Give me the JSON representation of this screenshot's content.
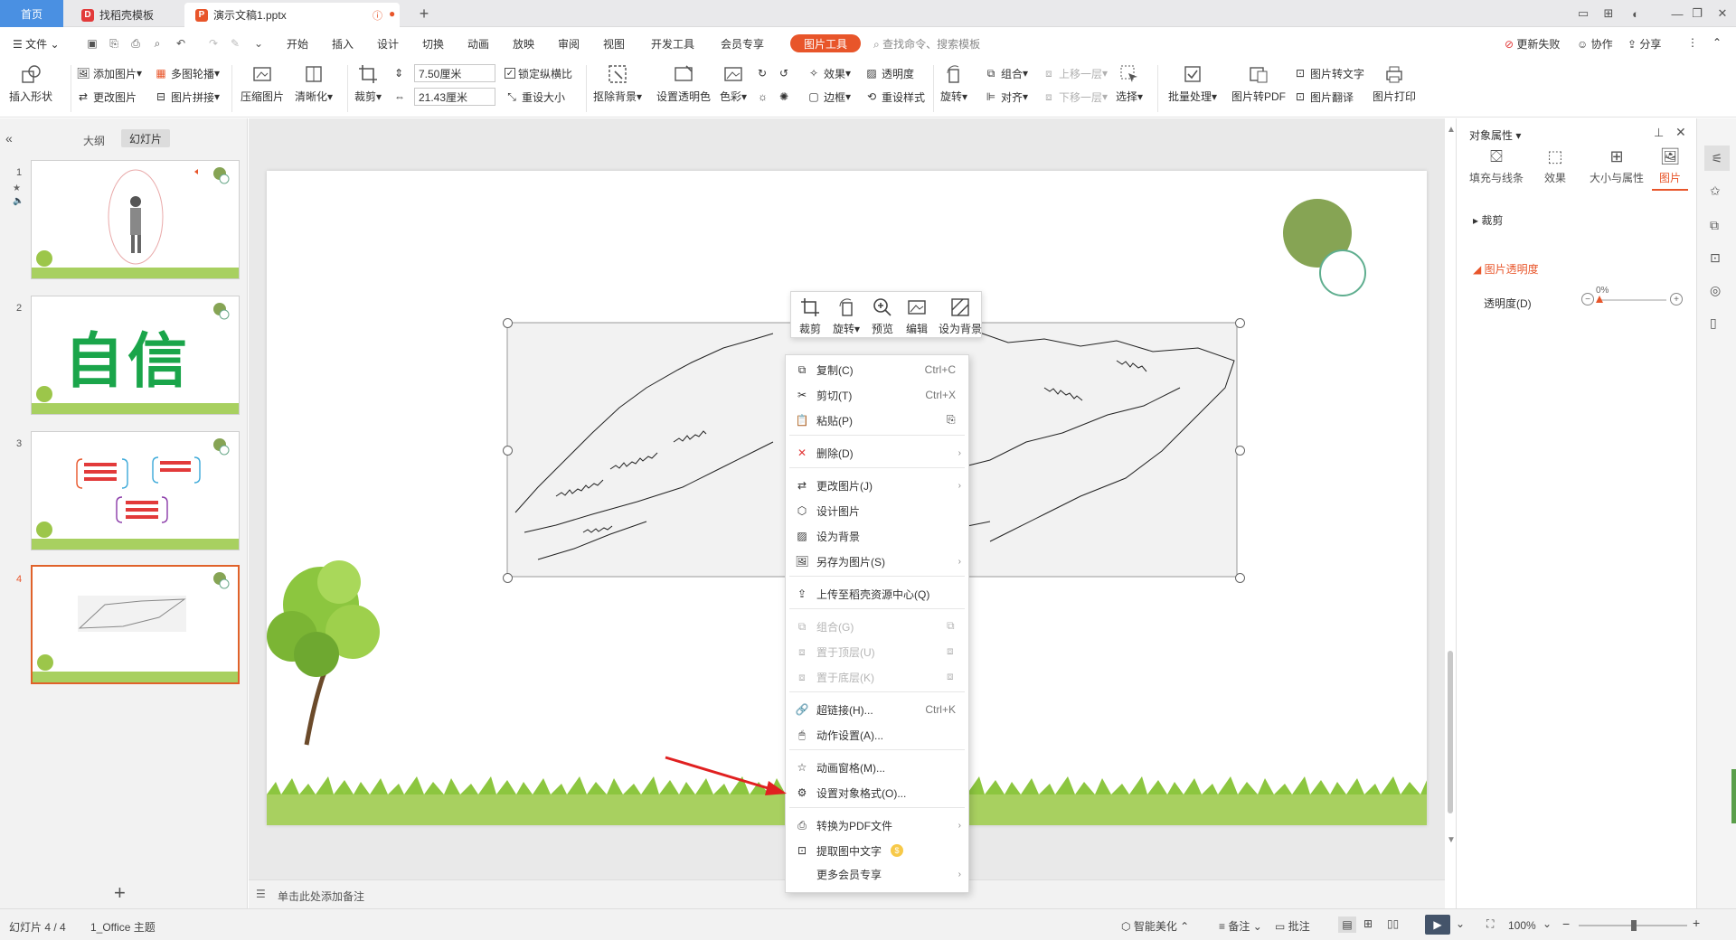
{
  "tabs": {
    "home": "首页",
    "template": "找稻壳模板",
    "document": "演示文稿1.pptx"
  },
  "menubar": {
    "file": "文件",
    "items": [
      "开始",
      "插入",
      "设计",
      "切换",
      "动画",
      "放映",
      "审阅",
      "视图",
      "开发工具",
      "会员专享"
    ],
    "active_tab": "图片工具",
    "search": "查找命令、搜索模板",
    "update_failed": "更新失败",
    "collaborate": "协作",
    "share": "分享"
  },
  "ribbon": {
    "insert_shape": "插入形状",
    "add_picture": "添加图片",
    "multi_outline": "多图轮播",
    "change_picture": "更改图片",
    "picture_splice": "图片拼接",
    "compress": "压缩图片",
    "sharpen": "清晰化",
    "crop": "裁剪",
    "width": "7.50厘米",
    "height": "21.43厘米",
    "lock_ratio": "锁定纵横比",
    "reset_size": "重设大小",
    "remove_bg": "抠除背景",
    "set_transparent": "设置透明色",
    "color": "色彩",
    "effect": "效果",
    "transparency": "透明度",
    "border": "边框",
    "reset_style": "重设样式",
    "rotate": "旋转",
    "group": "组合",
    "align": "对齐",
    "bring_forward": "上移一层",
    "send_backward": "下移一层",
    "select": "选择",
    "batch": "批量处理",
    "to_pdf": "图片转PDF",
    "to_text": "图片转文字",
    "translate": "图片翻译",
    "print": "图片打印"
  },
  "leftpanel": {
    "outline_tab": "大纲",
    "slides_tab": "幻灯片",
    "slide2_text": "自信",
    "slide_numbers": [
      "1",
      "2",
      "3",
      "4"
    ]
  },
  "minitoolbar": [
    "裁剪",
    "旋转",
    "预览",
    "编辑",
    "设为背景"
  ],
  "context_menu": [
    {
      "label": "复制(C)",
      "shortcut": "Ctrl+C"
    },
    {
      "label": "剪切(T)",
      "shortcut": "Ctrl+X"
    },
    {
      "label": "粘贴(P)",
      "shortcut": ""
    },
    {
      "label": "删除(D)",
      "shortcut": ""
    },
    {
      "label": "更改图片(J)",
      "shortcut": ""
    },
    {
      "label": "设计图片",
      "shortcut": ""
    },
    {
      "label": "设为背景",
      "shortcut": ""
    },
    {
      "label": "另存为图片(S)",
      "shortcut": ""
    },
    {
      "label": "上传至稻壳资源中心(Q)",
      "shortcut": ""
    },
    {
      "label": "组合(G)",
      "shortcut": ""
    },
    {
      "label": "置于顶层(U)",
      "shortcut": ""
    },
    {
      "label": "置于底层(K)",
      "shortcut": ""
    },
    {
      "label": "超链接(H)...",
      "shortcut": "Ctrl+K"
    },
    {
      "label": "动作设置(A)...",
      "shortcut": ""
    },
    {
      "label": "动画窗格(M)...",
      "shortcut": ""
    },
    {
      "label": "设置对象格式(O)...",
      "shortcut": ""
    },
    {
      "label": "转换为PDF文件",
      "shortcut": ""
    },
    {
      "label": "提取图中文字",
      "shortcut": ""
    },
    {
      "label": "更多会员专享",
      "shortcut": ""
    }
  ],
  "notes": "单击此处添加备注",
  "rightpanel": {
    "title": "对象属性",
    "tabs": [
      "填充与线条",
      "效果",
      "大小与属性",
      "图片"
    ],
    "crop_section": "裁剪",
    "transparency_section": "图片透明度",
    "transparency_label": "透明度(D)",
    "transparency_value": "0%"
  },
  "status": {
    "slide_count": "幻灯片 4 / 4",
    "theme": "1_Office 主题",
    "smart_beautify": "智能美化",
    "notes": "备注",
    "comments": "批注",
    "zoom": "100%"
  },
  "colors": {
    "accent": "#e8552a",
    "home_tab": "#4a90e2",
    "circle_green": "#86a454",
    "arrow": "#e02020"
  }
}
